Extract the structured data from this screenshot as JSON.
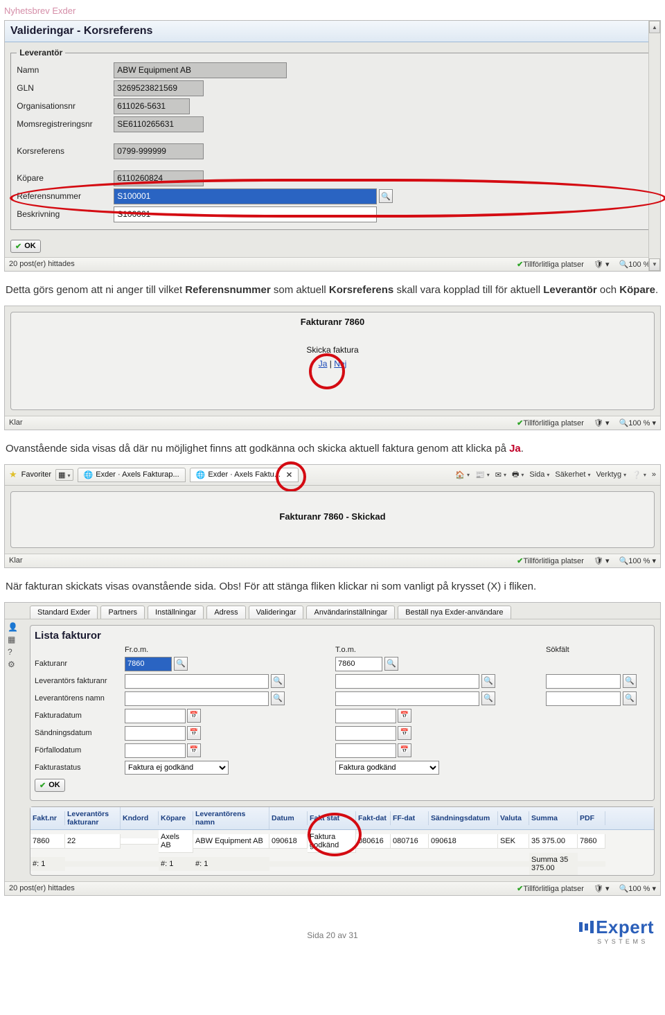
{
  "header": "Nyhetsbrev Exder",
  "screenshot1": {
    "title": "Valideringar - Korsreferens",
    "fieldset": "Leverantör",
    "fields": {
      "namn_label": "Namn",
      "namn": "ABW Equipment AB",
      "gln_label": "GLN",
      "gln": "3269523821569",
      "org_label": "Organisationsnr",
      "org": "611026-5631",
      "moms_label": "Momsregistreringsnr",
      "moms": "SE6110265631",
      "kors_label": "Korsreferens",
      "kors": "0799-999999",
      "kopare_label": "Köpare",
      "kopare": "6110260824",
      "ref_label": "Referensnummer",
      "ref": "S100001",
      "besk_label": "Beskrivning",
      "besk": "S100001"
    },
    "ok": "OK",
    "posts": "20 post(er) hittades",
    "trusted": "Tillförlitliga platser",
    "zoom": "100 %"
  },
  "para1_a": "Detta görs genom att ni anger till vilket ",
  "para1_b": "Referensnummer",
  "para1_c": " som aktuell ",
  "para1_d": "Korsreferens",
  "para1_e": " skall vara kopplad till för aktuell ",
  "para1_f": "Leverantör",
  "para1_g": " och ",
  "para1_h": "Köpare",
  "para1_i": ".",
  "screenshot2": {
    "title": "Fakturanr 7860",
    "sub": "Skicka faktura",
    "ja": "Ja",
    "nej": "Nej",
    "klar": "Klar",
    "trusted": "Tillförlitliga platser",
    "zoom": "100 %"
  },
  "para2_a": "Ovanstående sida visas då där nu möjlighet finns att godkänna och skicka aktuell faktura genom att klicka på ",
  "para2_b": "Ja",
  "para2_c": ".",
  "screenshot3": {
    "fav": "Favoriter",
    "tab1": "Exder · Axels Fakturap...",
    "tab2": "Exder · Axels Faktu...",
    "tb_sida": "Sida",
    "tb_sak": "Säkerhet",
    "tb_verk": "Verktyg",
    "title": "Fakturanr 7860 - Skickad",
    "klar": "Klar",
    "trusted": "Tillförlitliga platser",
    "zoom": "100 %"
  },
  "para3_a": "När fakturan skickats visas ovanstående sida. Obs! För att stänga fliken klickar ni som vanligt på krysset (X) i fliken.",
  "screenshot4": {
    "menus": [
      "Standard Exder",
      "Partners",
      "Inställningar",
      "Adress",
      "Valideringar",
      "Användarinställningar",
      "Beställ nya Exder-användare"
    ],
    "panel_title": "Lista fakturor",
    "from_label": "Fr.o.m.",
    "to_label": "T.o.m.",
    "sok_label": "Sökfält",
    "rows": {
      "fakturanr": "Fakturanr",
      "fakturanr_from": "7860",
      "fakturanr_to": "7860",
      "lev_fakt": "Leverantörs fakturanr",
      "lev_namn": "Leverantörens namn",
      "fakt_datum": "Fakturadatum",
      "sandning": "Sändningsdatum",
      "forfallo": "Förfallodatum",
      "faktstatus": "Fakturastatus",
      "fs_from": "Faktura ej godkänd",
      "fs_to": "Faktura godkänd"
    },
    "ok": "OK",
    "table": {
      "headers": [
        "Fakt.nr",
        "Leverantörs fakturanr",
        "Kndord",
        "Köpare",
        "Leverantörens namn",
        "Datum",
        "Fakt stat",
        "Fakt-dat",
        "FF-dat",
        "Sändningsdatum",
        "Valuta",
        "Summa",
        "PDF"
      ],
      "row": [
        "7860",
        "22",
        "",
        "Axels AB",
        "ABW Equipment AB",
        "090618",
        "Faktura godkänd",
        "080616",
        "080716",
        "090618",
        "SEK",
        "35 375.00",
        "7860"
      ],
      "foot": [
        "#: 1",
        "",
        "",
        "#: 1",
        "#: 1",
        "",
        "",
        "",
        "",
        "",
        "",
        "Summa 35 375.00",
        ""
      ]
    },
    "posts": "20 post(er) hittades",
    "trusted": "Tillförlitliga platser",
    "zoom": "100 %"
  },
  "footer_page": "Sida 20 av 31",
  "logo_main": "Expert",
  "logo_sub": "S Y S T E M S"
}
